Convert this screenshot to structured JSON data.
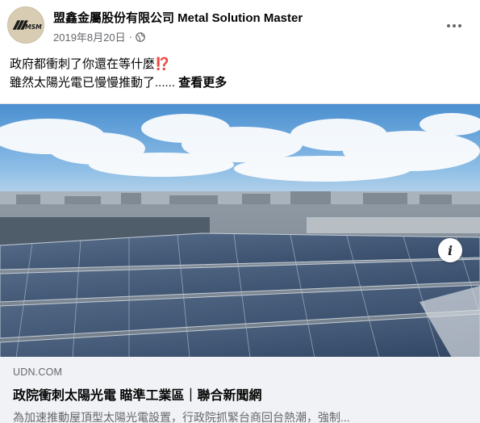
{
  "post": {
    "page_name": "盟鑫金屬股份有限公司 Metal Solution Master",
    "date": "2019年8月20日",
    "separator": "·",
    "privacy_icon": "globe-icon",
    "more_icon": "more-options-icon",
    "avatar_logo_text": "MSM",
    "text_line1": "政府都衝刺了你還在等什麼",
    "emoji": "⁉️",
    "text_line2": "雖然太陽光電已慢慢推動了......",
    "see_more": "查看更多"
  },
  "link_preview": {
    "domain": "UDN.COM",
    "title": "政院衝刺太陽光電 瞄準工業區｜聯合新聞網",
    "description": "為加速推動屋頂型太陽光電設置，行政院抓緊台商回台熱潮，強制...",
    "info_icon": "info-icon",
    "info_label": "i",
    "image_subject": "rooftop-solar-panels-photo"
  },
  "colors": {
    "text_primary": "#050505",
    "text_secondary": "#65676b",
    "footer_bg": "#f0f2f5",
    "panel_blue": "#3a4f6e",
    "sky_blue": "#5b9bd5"
  }
}
